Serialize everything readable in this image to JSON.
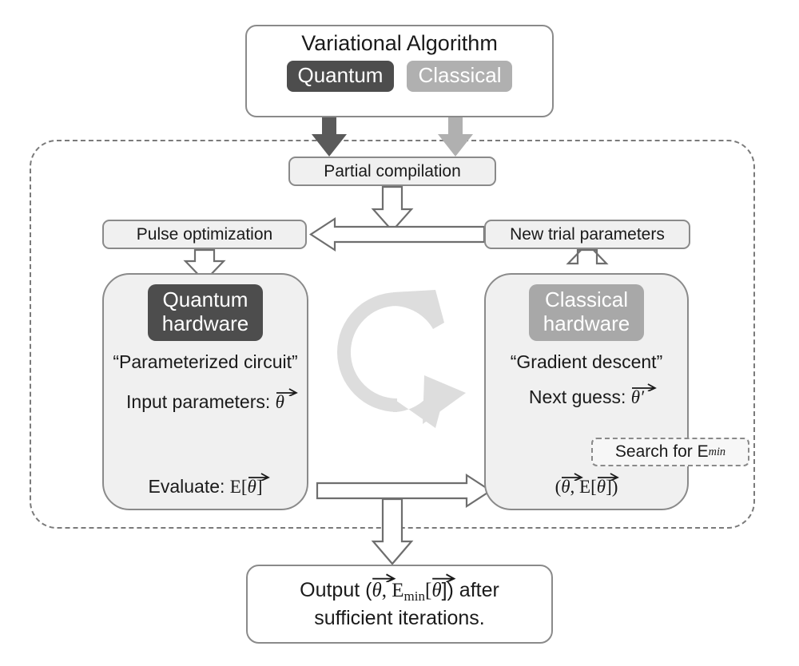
{
  "diagram": {
    "title_top": "Variational Algorithm",
    "badges": {
      "quantum": "Quantum",
      "classical": "Classical"
    },
    "colors": {
      "quantum_dark": "#4d4d4d",
      "classical_light": "#b0b0b0",
      "panel_fill": "#f0f0f0",
      "border": "#8a8a8a",
      "dashed_border": "#7a7a7a",
      "cycle_arrow": "#dddddd",
      "hollow_arrow_stroke": "#6e6e6e"
    },
    "nodes": {
      "partial_compilation": "Partial compilation",
      "pulse_optimization": "Pulse optimization",
      "new_trial_parameters": "New trial parameters",
      "search_for_emin_prefix": "Search for E",
      "search_for_emin_sub": "min"
    },
    "quantum_panel": {
      "badge_line1": "Quantum",
      "badge_line2": "hardware",
      "quote": "“Parameterized circuit”",
      "input_label": "Input parameters: ",
      "input_symbol": "θ",
      "evaluate_label": "Evaluate: ",
      "evaluate_expr_open": "E[",
      "evaluate_symbol": "θ",
      "evaluate_expr_close": "]"
    },
    "classical_panel": {
      "badge_line1": "Classical",
      "badge_line2": "hardware",
      "quote": "“Gradient descent”",
      "next_guess_label": "Next guess: ",
      "next_guess_symbol": "θ′",
      "pair_open": "(",
      "pair_theta": "θ",
      "pair_comma": ", ",
      "pair_e_open": "E[",
      "pair_e_theta": "θ",
      "pair_e_close": "]",
      "pair_close": ")"
    },
    "output": {
      "line1_a": "Output (",
      "line1_theta": "θ",
      "line1_b": ", E",
      "line1_sub": "min",
      "line1_c": "[",
      "line1_theta2": "θ",
      "line1_d": "]) after",
      "line2": "sufficient iterations."
    }
  }
}
